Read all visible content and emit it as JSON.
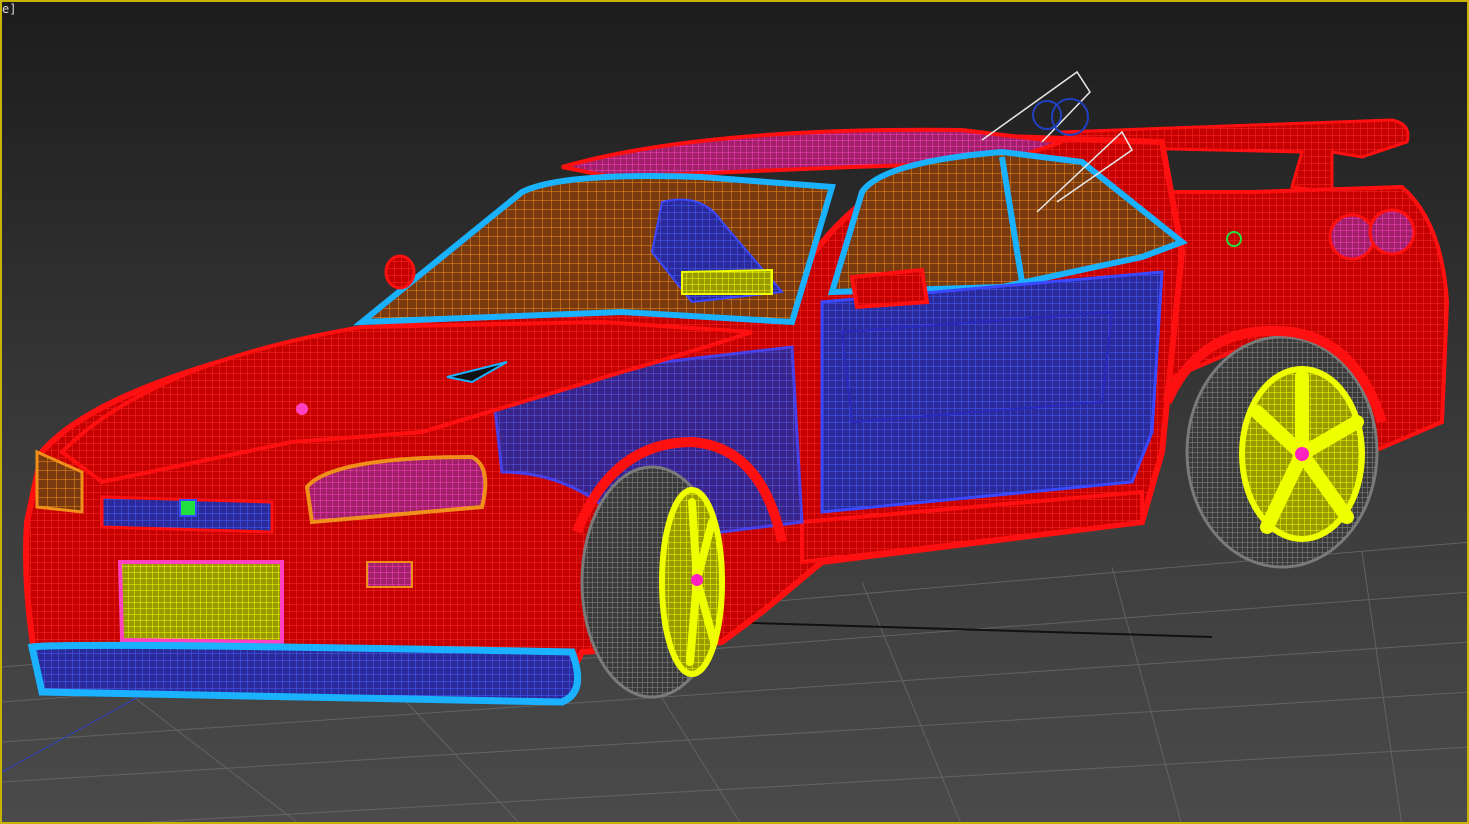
{
  "viewport": {
    "label": "e]",
    "active_border_color": "#c8b400"
  },
  "scene": {
    "render_mode": "wireframe",
    "object": "car",
    "colors": {
      "body": "#ff1010",
      "trim": "#1ab2ff",
      "interior": "#3a48ff",
      "glass": "#f0901a",
      "wheels": "#f0ff00",
      "tires": "#8a8a8a",
      "lights": "#ff40c0",
      "grid": "#6a6a6a"
    }
  }
}
